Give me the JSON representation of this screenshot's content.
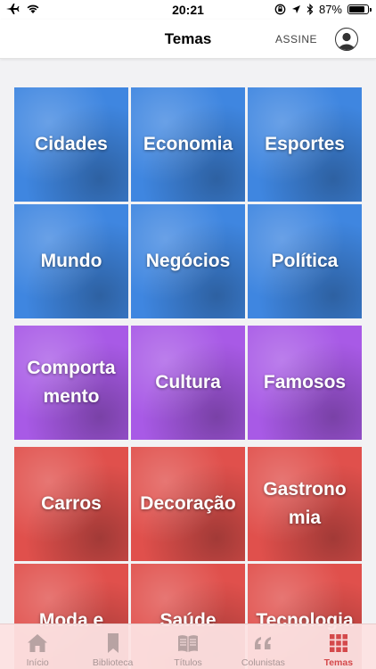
{
  "status_bar": {
    "time": "20:21",
    "battery": "87%",
    "battery_level": 0.87
  },
  "nav": {
    "title": "Temas",
    "assine": "ASSINE"
  },
  "tiles": [
    {
      "label": "Cidades",
      "color": "#3f86e0"
    },
    {
      "label": "Economia",
      "color": "#3f86e0"
    },
    {
      "label": "Esportes",
      "color": "#3f86e0"
    },
    {
      "label": "Mundo",
      "color": "#3f86e0"
    },
    {
      "label": "Negócios",
      "color": "#3f86e0"
    },
    {
      "label": "Política",
      "color": "#3f86e0"
    },
    {
      "label": "Comporta mento",
      "color": "#a85ae6"
    },
    {
      "label": "Cultura",
      "color": "#a85ae6"
    },
    {
      "label": "Famosos",
      "color": "#a85ae6"
    },
    {
      "label": "Carros",
      "color": "#e0504c"
    },
    {
      "label": "Decoração",
      "color": "#e0504c"
    },
    {
      "label": "Gastrono mia",
      "color": "#e0504c"
    },
    {
      "label": "Moda e",
      "color": "#e0504c"
    },
    {
      "label": "Saúde",
      "color": "#e0504c"
    },
    {
      "label": "Tecnologia",
      "color": "#e0504c"
    }
  ],
  "tabs": [
    {
      "label": "Início",
      "icon": "home-icon"
    },
    {
      "label": "Biblioteca",
      "icon": "bookmark-icon"
    },
    {
      "label": "Títulos",
      "icon": "book-icon"
    },
    {
      "label": "Colunistas",
      "icon": "quote-icon"
    },
    {
      "label": "Temas",
      "icon": "grid-icon"
    }
  ],
  "active_tab": "Temas"
}
